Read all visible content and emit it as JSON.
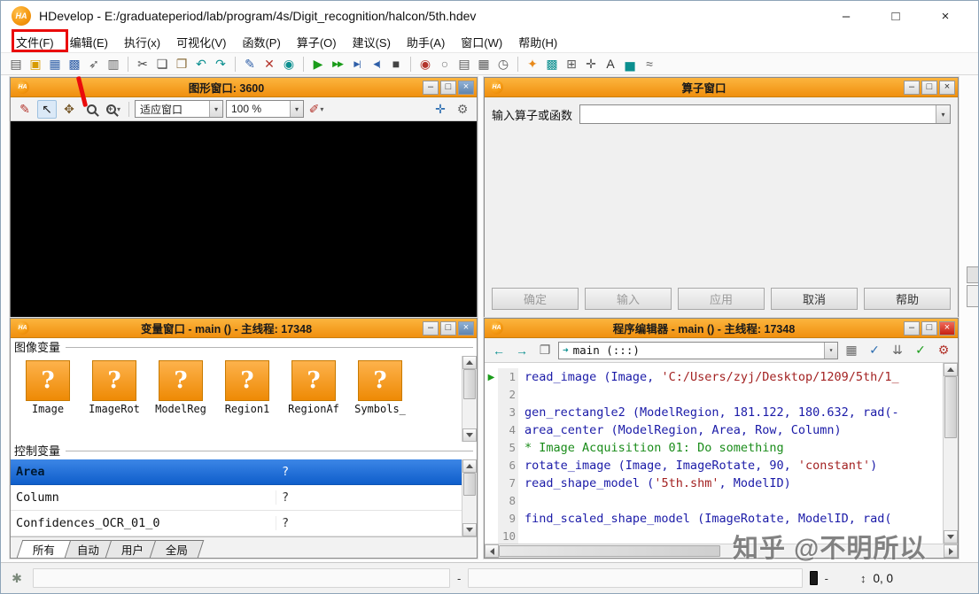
{
  "window": {
    "logo": "HA",
    "title": "HDevelop - E:/graduateperiod/lab/program/4s/Digit_recognition/halcon/5th.hdev",
    "minimize": "–",
    "maximize": "□",
    "close": "×"
  },
  "menu_bar": {
    "items": [
      "文件(F)",
      "编辑(E)",
      "执行(x)",
      "可视化(V)",
      "函数(P)",
      "算子(O)",
      "建议(S)",
      "助手(A)",
      "窗口(W)",
      "帮助(H)"
    ]
  },
  "toolbar": {
    "groups": [
      [
        {
          "name": "new-program-icon",
          "glyph": "▤",
          "color": "#5a5a5a"
        },
        {
          "name": "open-program-icon",
          "glyph": "▣",
          "color": "#d79b00"
        },
        {
          "name": "save-program-icon",
          "glyph": "▦",
          "color": "#2f5fa8"
        },
        {
          "name": "save-all-icon",
          "glyph": "▩",
          "color": "#2f5fa8"
        },
        {
          "name": "export-program-icon",
          "glyph": "➶",
          "color": "#5a5a5a"
        },
        {
          "name": "print-icon",
          "glyph": "▥",
          "color": "#5a5a5a"
        }
      ],
      [
        {
          "name": "cut-icon",
          "glyph": "✂",
          "color": "#444444"
        },
        {
          "name": "copy-icon",
          "glyph": "❏",
          "color": "#444444"
        },
        {
          "name": "paste-icon",
          "glyph": "❐",
          "color": "#8a6d3b"
        },
        {
          "name": "undo-icon",
          "glyph": "↶",
          "color": "#0b8f8f"
        },
        {
          "name": "redo-icon",
          "glyph": "↷",
          "color": "#0b8f8f"
        }
      ],
      [
        {
          "name": "insert-line-icon",
          "glyph": "✎",
          "color": "#2f5fa8"
        },
        {
          "name": "delete-line-icon",
          "glyph": "✕",
          "color": "#b3342c"
        },
        {
          "name": "find-icon",
          "glyph": "◉",
          "color": "#0b8f8f"
        }
      ],
      [
        {
          "name": "run-icon",
          "glyph": "▶",
          "color": "#1a9c1a"
        },
        {
          "name": "step-over-icon",
          "glyph": "▶▶",
          "color": "#1a9c1a",
          "small": true
        },
        {
          "name": "step-into-icon",
          "glyph": "▶|",
          "color": "#2f5fa8",
          "small": true
        },
        {
          "name": "step-out-icon",
          "glyph": "◀|",
          "color": "#2f5fa8",
          "small": true
        },
        {
          "name": "stop-icon",
          "glyph": "■",
          "color": "#444444"
        }
      ],
      [
        {
          "name": "set-breakpoint-icon",
          "glyph": "◉",
          "color": "#b3342c"
        },
        {
          "name": "activate-breakpoints-icon",
          "glyph": "○",
          "color": "#777777"
        },
        {
          "name": "profiler-icon",
          "glyph": "▤",
          "color": "#5a5a5a"
        },
        {
          "name": "film-strip-icon",
          "glyph": "▦",
          "color": "#5a5a5a"
        },
        {
          "name": "timer-icon",
          "glyph": "◷",
          "color": "#5a5a5a"
        }
      ],
      [
        {
          "name": "image-acquisition-assistant-icon",
          "glyph": "✦",
          "color": "#e8891a"
        },
        {
          "name": "matching-assistant-icon",
          "glyph": "▩",
          "color": "#0b8f8f"
        },
        {
          "name": "calibration-assistant-icon",
          "glyph": "⊞",
          "color": "#5a5a5a"
        },
        {
          "name": "measure-assistant-icon",
          "glyph": "✛",
          "color": "#5a5a5a"
        },
        {
          "name": "ocr-assistant-icon",
          "glyph": "A",
          "color": "#333333"
        },
        {
          "name": "gray-histogram-icon",
          "glyph": "▅",
          "color": "#0b8f8f"
        },
        {
          "name": "feature-inspection-icon",
          "glyph": "≈",
          "color": "#5a5a5a"
        }
      ]
    ]
  },
  "graphics_window": {
    "title": "图形窗口: 3600",
    "icons_left": [
      {
        "name": "set-display-parameters-icon",
        "glyph": "✎",
        "color": "#b3342c"
      },
      {
        "name": "pointer-select-icon",
        "glyph": "↖",
        "color": "#222222",
        "pressed": true
      },
      {
        "name": "pan-hand-icon",
        "glyph": "✥",
        "color": "#7a5c2e"
      },
      {
        "name": "zoom-magnifier-icon",
        "css": "mag"
      },
      {
        "name": "zoom-mode-magnifier-icon",
        "css": "mag plus",
        "dropdown": true
      }
    ],
    "fit_mode": "适应窗口",
    "zoom_level": "100 %",
    "paint_icon": {
      "name": "paint-mode-icon",
      "glyph": "✐",
      "color": "#b3342c",
      "dropdown": true
    },
    "icons_right": [
      {
        "name": "move-origin-icon",
        "glyph": "✛",
        "color": "#2b6cb0"
      },
      {
        "name": "display-settings-icon",
        "glyph": "⚙",
        "color": "#666666"
      }
    ]
  },
  "operator_window": {
    "title": "算子窗口",
    "input_label": "输入算子或函数",
    "buttons": [
      {
        "label": "确定",
        "enabled": false
      },
      {
        "label": "输入",
        "enabled": false
      },
      {
        "label": "应用",
        "enabled": false
      },
      {
        "label": "取消",
        "enabled": true
      },
      {
        "label": "帮助",
        "enabled": true
      }
    ]
  },
  "variable_window": {
    "title": "变量窗口 - main () - 主线程: 17348",
    "image_section_label": "图像变量",
    "control_section_label": "控制变量",
    "unknown_glyph": "?",
    "image_variables": [
      "Image",
      "ImageRot",
      "ModelReg",
      "Region1",
      "RegionAf",
      "Symbols_"
    ],
    "control_variables": [
      {
        "name": "Area",
        "value": "?",
        "selected": true
      },
      {
        "name": "Column",
        "value": "?",
        "selected": false
      },
      {
        "name": "Confidences_OCR_01_0",
        "value": "?",
        "selected": false
      }
    ],
    "tabs": [
      {
        "label": "所有",
        "active": true
      },
      {
        "label": "自动",
        "active": false
      },
      {
        "label": "用户",
        "active": false
      },
      {
        "label": "全局",
        "active": false
      }
    ]
  },
  "program_editor": {
    "title": "程序编辑器 - main () - 主线程: 17348",
    "procedure": "main (:::)",
    "procedure_icon_glyph": "➜",
    "exec_arrow": "▶",
    "toolbar_icons_left": [
      {
        "name": "navigate-back-icon",
        "glyph": "←",
        "color": "#0b8f8f"
      },
      {
        "name": "navigate-forward-icon",
        "glyph": "→",
        "color": "#0b8f8f"
      },
      {
        "name": "clipboard-icon",
        "glyph": "❐",
        "color": "#666666"
      }
    ],
    "toolbar_icons_right": [
      {
        "name": "procedure-interface-icon",
        "glyph": "▦",
        "color": "#666666"
      },
      {
        "name": "syntax-check-icon",
        "glyph": "✓",
        "color": "#2b6cb0"
      },
      {
        "name": "auto-format-icon",
        "glyph": "⇊",
        "color": "#666666"
      },
      {
        "name": "apply-procedure-icon",
        "glyph": "✓",
        "color": "#1a9c1a"
      },
      {
        "name": "procedure-settings-icon",
        "glyph": "⚙",
        "color": "#b3342c"
      }
    ],
    "lines": [
      {
        "num": "1",
        "arrow": true,
        "segments": [
          {
            "type": "code",
            "text": "read_image (Image, "
          },
          {
            "type": "string",
            "text": "'C:/Users/zyj/Desktop/1209/5th/1_"
          }
        ]
      },
      {
        "num": "2",
        "segments": []
      },
      {
        "num": "3",
        "segments": [
          {
            "type": "code",
            "text": "gen_rectangle2 (ModelRegion, 181.122, 180.632, rad(-"
          }
        ]
      },
      {
        "num": "4",
        "segments": [
          {
            "type": "code",
            "text": "area_center (ModelRegion, Area, Row, Column)"
          }
        ]
      },
      {
        "num": "5",
        "segments": [
          {
            "type": "comment",
            "text": "* Image Acquisition 01: Do something"
          }
        ]
      },
      {
        "num": "6",
        "segments": [
          {
            "type": "code",
            "text": "rotate_image (Image, ImageRotate, 90, "
          },
          {
            "type": "string",
            "text": "'constant'"
          },
          {
            "type": "code",
            "text": ")"
          }
        ]
      },
      {
        "num": "7",
        "segments": [
          {
            "type": "code",
            "text": "read_shape_model ("
          },
          {
            "type": "string",
            "text": "'5th.shm'"
          },
          {
            "type": "code",
            "text": ", ModelID)"
          }
        ]
      },
      {
        "num": "8",
        "segments": []
      },
      {
        "num": "9",
        "segments": [
          {
            "type": "code",
            "text": "find_scaled_shape_model (ImageRotate, ModelID, rad("
          }
        ]
      },
      {
        "num": "10",
        "segments": []
      }
    ]
  },
  "status_bar": {
    "icon_glyph": "✱",
    "left_dash": "-",
    "memory_dash": "-",
    "updown_glyph": "↕",
    "coordinates": "0,  0"
  },
  "watermark": "知乎 @不明所以",
  "annotation": {
    "color": "#ea0b0b",
    "highlighted_menu": "文件(F)"
  }
}
